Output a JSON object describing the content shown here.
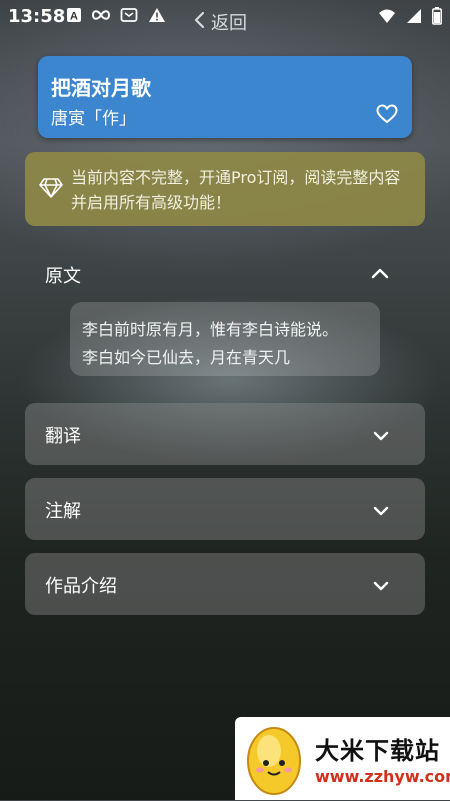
{
  "status_bar": {
    "time": "13:58",
    "left_icons": [
      "a-icon",
      "infinity-icon",
      "cast-icon",
      "warning-icon"
    ],
    "right_icons": [
      "wifi-icon",
      "signal-icon",
      "battery-icon"
    ]
  },
  "nav": {
    "back_label": "返回"
  },
  "poem": {
    "title": "把酒对月歌",
    "author": "唐寅「作」"
  },
  "pro_banner": {
    "text": "当前内容不完整，开通Pro订阅，阅读完整内容并启用所有高级功能！"
  },
  "sections": {
    "original": {
      "label": "原文",
      "expanded": true,
      "lines": [
        "李白前时原有月，惟有李白诗能说。",
        "李白如今已仙去，月在青天几"
      ]
    },
    "translation": {
      "label": "翻译",
      "expanded": false
    },
    "notes": {
      "label": "注解",
      "expanded": false
    },
    "intro": {
      "label": "作品介绍",
      "expanded": false
    }
  },
  "watermark": {
    "name": "大米下载站",
    "url": "www.zzhyw.com"
  },
  "colors": {
    "title_card": "#3b86cf",
    "pro_banner": "#8e8846",
    "watermark_url": "#d3301c"
  }
}
